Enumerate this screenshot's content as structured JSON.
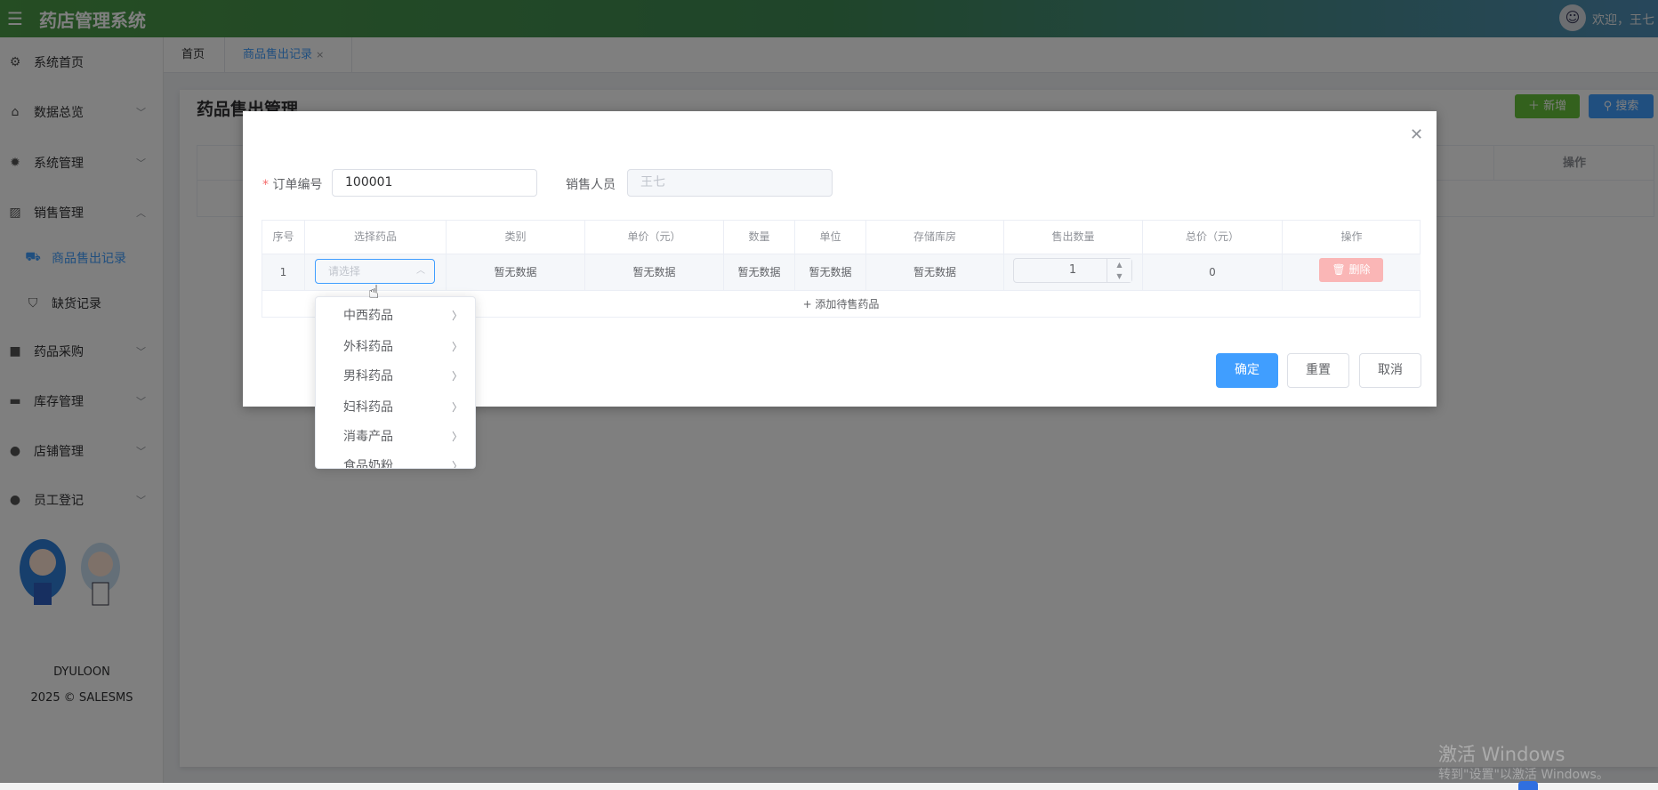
{
  "header": {
    "title": "药店管理系统",
    "welcome": "欢迎，王七"
  },
  "sidebar": {
    "items": [
      {
        "label": "系统首页",
        "icon": "gear-outline-icon"
      },
      {
        "label": "数据总览",
        "icon": "home-icon"
      },
      {
        "label": "系统管理",
        "icon": "gear-icon"
      },
      {
        "label": "销售管理",
        "icon": "chart-icon"
      },
      {
        "label": "商品售出记录",
        "icon": "truck-icon"
      },
      {
        "label": "缺货记录",
        "icon": "bag-icon"
      },
      {
        "label": "药品采购",
        "icon": "shopping-bag-icon"
      },
      {
        "label": "库存管理",
        "icon": "briefcase-icon"
      },
      {
        "label": "店铺管理",
        "icon": "user-icon"
      },
      {
        "label": "员工登记",
        "icon": "user-icon"
      }
    ],
    "developer": "DYULOON",
    "copyright": "2025 © SALESMS"
  },
  "tabs": [
    {
      "label": "首页"
    },
    {
      "label": "商品售出记录",
      "close": "×"
    }
  ],
  "page": {
    "title": "药品售出管理",
    "add_label": "新增",
    "search_label": "搜索",
    "table_op": "操作",
    "add_color": "#67c23a",
    "search_color": "#409eff"
  },
  "modal": {
    "order_label": "订单编号",
    "order_value": "100001",
    "seller_label": "销售人员",
    "seller_value": "王七",
    "columns": [
      "序号",
      "选择药品",
      "类别",
      "单价（元）",
      "数量",
      "单位",
      "存储库房",
      "售出数量",
      "总价（元）",
      "操作"
    ],
    "row": {
      "index": "1",
      "select_placeholder": "请选择",
      "category": "暂无数据",
      "price": "暂无数据",
      "stock": "暂无数据",
      "unit": "暂无数据",
      "warehouse": "暂无数据",
      "qty": "1",
      "total": "0",
      "delete": "删除"
    },
    "add_row": "+ 添加待售药品",
    "confirm": "确定",
    "reset": "重置",
    "cancel": "取消",
    "dropdown": [
      "中西药品",
      "外科药品",
      "男科药品",
      "妇科药品",
      "消毒产品",
      "食品奶粉"
    ]
  },
  "watermark": {
    "line1": "激活 Windows",
    "line2": "转到\"设置\"以激活 Windows。"
  }
}
